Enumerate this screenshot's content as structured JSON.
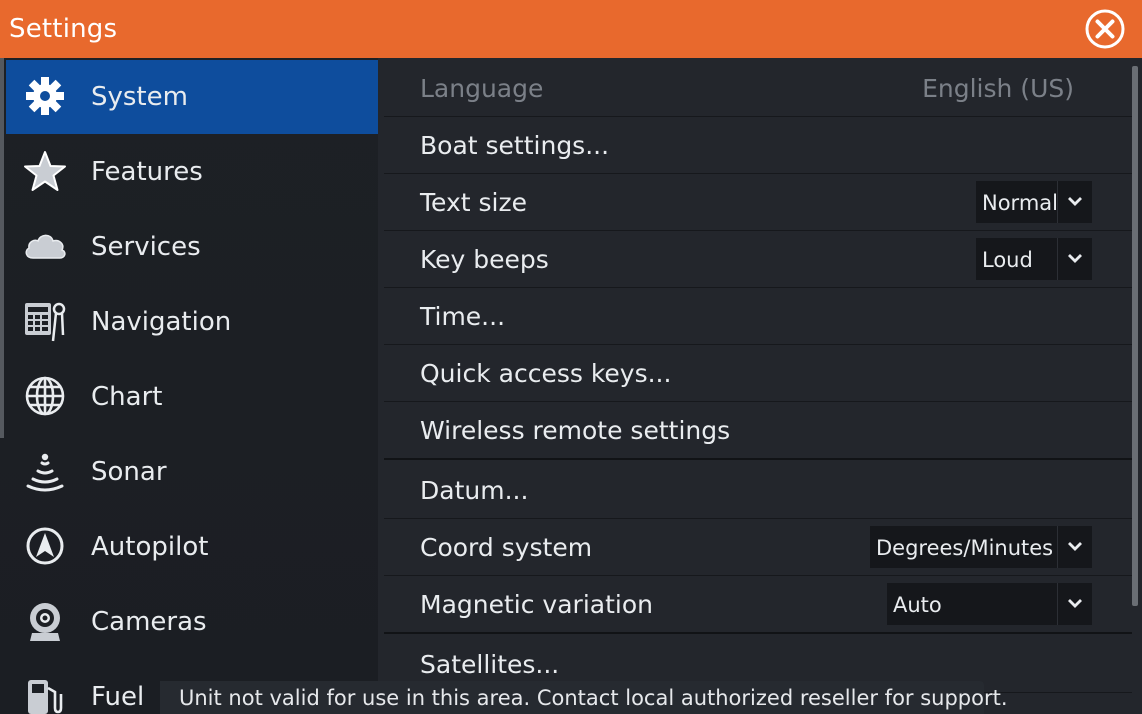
{
  "window": {
    "title": "Settings"
  },
  "sidebar": {
    "items": [
      {
        "label": "System",
        "icon": "gear-icon",
        "selected": true
      },
      {
        "label": "Features",
        "icon": "star-icon"
      },
      {
        "label": "Services",
        "icon": "cloud-icon"
      },
      {
        "label": "Navigation",
        "icon": "navigation-icon"
      },
      {
        "label": "Chart",
        "icon": "globe-icon"
      },
      {
        "label": "Sonar",
        "icon": "sonar-icon"
      },
      {
        "label": "Autopilot",
        "icon": "autopilot-icon"
      },
      {
        "label": "Cameras",
        "icon": "camera-icon"
      },
      {
        "label": "Fuel",
        "icon": "fuel-icon"
      }
    ]
  },
  "settings": {
    "language": {
      "label": "Language",
      "value": "English (US)"
    },
    "boat_settings": {
      "label": "Boat settings..."
    },
    "text_size": {
      "label": "Text size",
      "value": "Normal"
    },
    "key_beeps": {
      "label": "Key beeps",
      "value": "Loud"
    },
    "time": {
      "label": "Time..."
    },
    "quick_access_keys": {
      "label": "Quick access keys..."
    },
    "wireless_remote": {
      "label": "Wireless remote settings"
    },
    "datum": {
      "label": "Datum..."
    },
    "coord_system": {
      "label": "Coord system",
      "value": "Degrees/Minutes"
    },
    "magnetic_variation": {
      "label": "Magnetic variation",
      "value": "Auto"
    },
    "satellites": {
      "label": "Satellites..."
    }
  },
  "status": {
    "message": "Unit not valid for use in this area.  Contact local authorized reseller for support."
  },
  "colors": {
    "title_bar": "#e8692d",
    "selected": "#0e4d9d",
    "background": "#23262c"
  }
}
